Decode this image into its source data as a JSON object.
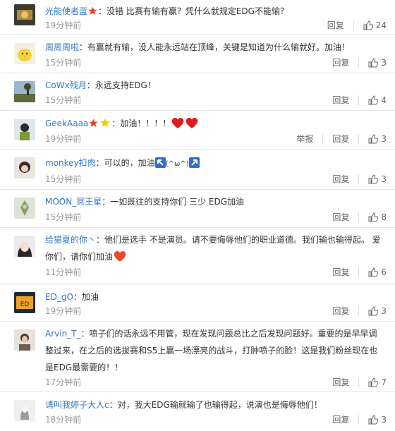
{
  "comments": [
    {
      "user": "光能使者蓝",
      "text": "没错 比赛有输有赢？凭什么就规定EDG不能输？",
      "time": "19分钟前",
      "reply": "回复",
      "likes": "24"
    },
    {
      "user": "周周周啦",
      "text": "有赢就有输，没人能永远站在顶峰，关键是知道为什么输就好。加油！",
      "time": "15分钟前",
      "reply": "回复",
      "likes": "3"
    },
    {
      "user": "CoWx残月",
      "text": "永远支持EDG！",
      "time": "15分钟前",
      "reply": "回复",
      "likes": "4"
    },
    {
      "user": "GeekAaaa",
      "text": "加油！！！！",
      "time": "19分钟前",
      "report": "举报",
      "reply": "回复",
      "likes": "3"
    },
    {
      "user": "monkey扣肉",
      "text": "可以的，加油",
      "kaomoji": "(^ω^)",
      "time": "15分钟前",
      "reply": "回复",
      "likes": "3"
    },
    {
      "user": "MOON_冥王星",
      "text": "一如既往的支持你们 三少 EDG加油",
      "time": "15分钟前",
      "reply": "回复",
      "likes": "8"
    },
    {
      "user": "给猫夏的你丶",
      "text1": "他们是选手 不是演员。请不要侮辱他们的职业道德。我们输也输得起。 爱",
      "text2": "你们，请你们加油",
      "time": "11分钟前",
      "reply": "回复",
      "likes": "6"
    },
    {
      "user": "ED_gO",
      "text": "加油",
      "time": "19分钟前",
      "reply": "回复",
      "likes": "3"
    },
    {
      "user": "Arvin_T_",
      "text1": "喷子们的话永远不用管，现在发现问题总比之后发现问题好。重要的是早早调",
      "text2": "整过来，在之后的选拔赛和S5上赢一场漂亮的战斗，打肿喷子的脸！这是我们粉丝现在也",
      "text3": "是EDG最需要的！！",
      "time": "17分钟前",
      "reply": "回复",
      "likes": "7"
    },
    {
      "user": "请叫我婷子大人c",
      "text": "对，我大EDG输就输了也输得起，说演也是侮辱他们！",
      "time": "18分钟前",
      "reply": "回复",
      "likes": "3"
    }
  ],
  "colors": {
    "username": "#eb7350",
    "username_blue": "#3478c5",
    "muted": "#999999"
  }
}
